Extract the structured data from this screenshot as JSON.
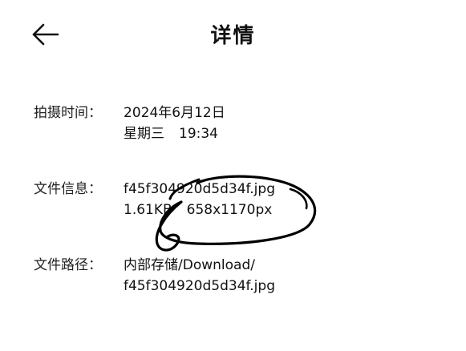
{
  "header": {
    "title": "详情",
    "back_icon": "arrow-left-icon"
  },
  "details": {
    "shot_time": {
      "label": "拍摄时间：",
      "date": "2024年6月12日",
      "weekday": "星期三",
      "time": "19:34"
    },
    "file_info": {
      "label": "文件信息：",
      "filename": "f45f304920d5d34f.jpg",
      "size": "1.61KB",
      "dimensions": "658x1170px"
    },
    "file_path": {
      "label": "文件路径：",
      "folder": "内部存储/Download/",
      "filename": "f45f304920d5d34f.jpg"
    }
  },
  "colors": {
    "background": "#ffffff",
    "text": "#111111",
    "scribble": "#000000"
  }
}
